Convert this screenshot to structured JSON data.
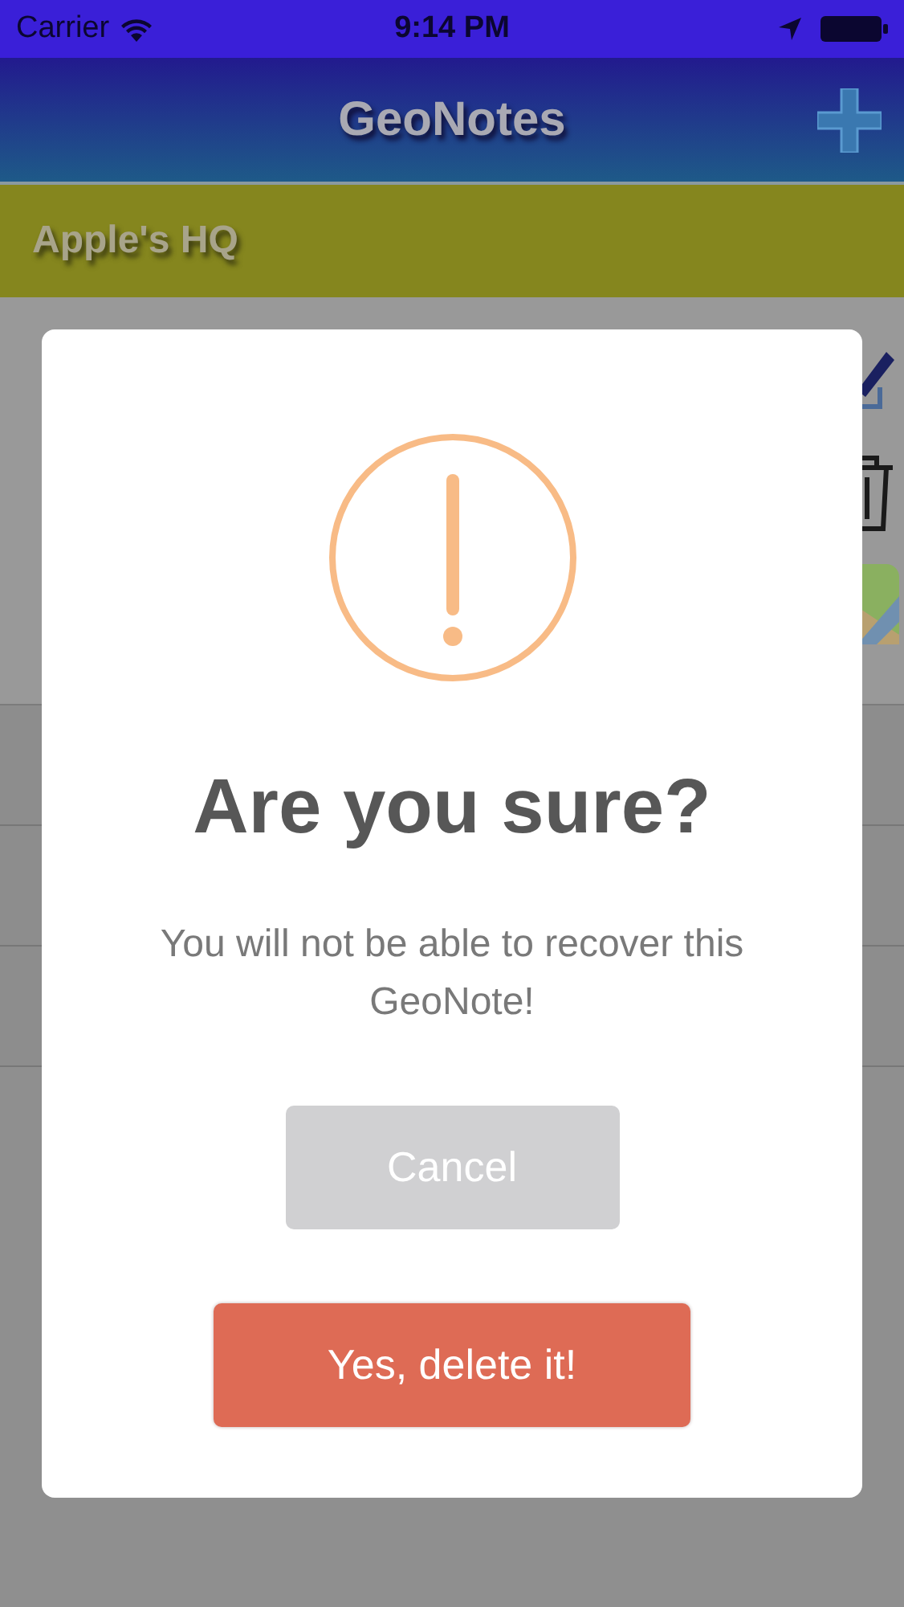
{
  "status_bar": {
    "carrier": "Carrier",
    "time": "9:14 PM"
  },
  "nav_bar": {
    "title": "GeoNotes"
  },
  "section_header": {
    "title": "Apple's HQ"
  },
  "alert": {
    "title": "Are you sure?",
    "message": "You will not be able to recover this GeoNote!",
    "buttons": [
      {
        "label": "Cancel",
        "kind": "cancel"
      },
      {
        "label": "Yes, delete it!",
        "kind": "confirm"
      }
    ]
  }
}
